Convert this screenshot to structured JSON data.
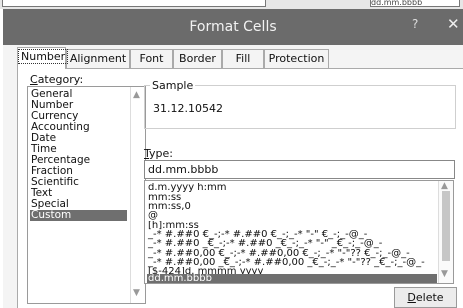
{
  "background_sheet": {
    "cell_text": "dd.mm.bbbb"
  },
  "window": {
    "title": "Format Cells",
    "help_label": "?",
    "close_label": "✕"
  },
  "tabs": [
    "Number",
    "Alignment",
    "Font",
    "Border",
    "Fill",
    "Protection"
  ],
  "active_tab": "Number",
  "category": {
    "label_accel": "C",
    "label_rest": "ategory:",
    "items": [
      "General",
      "Number",
      "Currency",
      "Accounting",
      "Date",
      "Time",
      "Percentage",
      "Fraction",
      "Scientific",
      "Text",
      "Special",
      "Custom"
    ],
    "selected": "Custom"
  },
  "sample": {
    "label": "Sample",
    "value": "31.12.10542"
  },
  "type": {
    "label_accel": "T",
    "label_rest": "ype:",
    "value": "dd.mm.bbbb"
  },
  "format_list": [
    "d.m.yyyy h:mm",
    "mm:ss",
    "mm:ss,0",
    "@",
    "[h]:mm:ss",
    "_-* #.##0 €_-;-* #.##0 €_-;_-* \"-\" €_-;_-@_-",
    "_-* #.##0 _€_-;-* #.##0 _€_-;_-* \"-\" _€_-;_-@_-",
    "_-* #.##0,00 €_-;-* #.##0,00 €_-;_-* \"-\"?? €_-;_-@_-",
    "_-* #.##0,00 _€_-;-* #.##0,00 _€_-;_-* \"-\"?? _€_-;_-@_-",
    "[$-424]d. mmmm yyyy",
    "dd.mm.bbbb"
  ],
  "format_selected": "dd.mm.bbbb",
  "delete_button": {
    "accel": "D",
    "rest": "elete"
  },
  "icons": {
    "scroll_up": "▲",
    "scroll_down": "▼"
  }
}
